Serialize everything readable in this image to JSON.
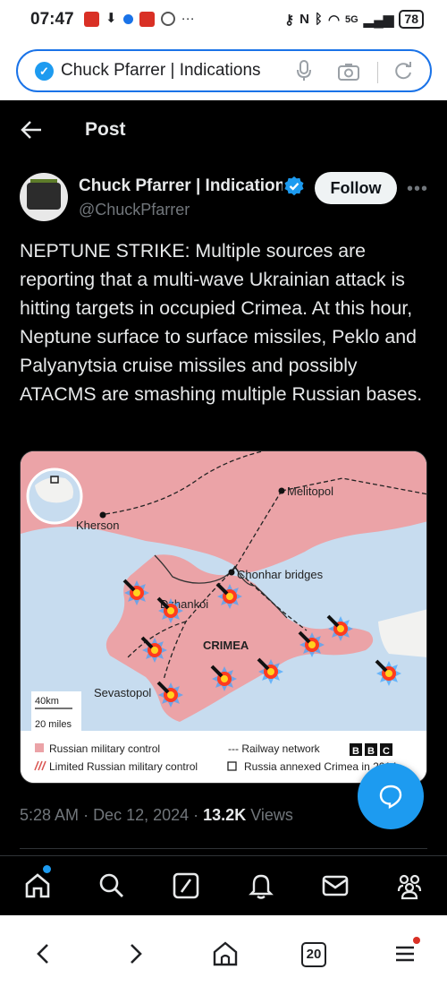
{
  "status_bar": {
    "time": "07:47",
    "signal": "5G",
    "battery": "78"
  },
  "address_bar": {
    "title": "Chuck Pfarrer | Indications"
  },
  "header": {
    "title": "Post"
  },
  "post": {
    "author_name": "Chuck Pfarrer | Indications",
    "author_handle": "@ChuckPfarrer",
    "follow_label": "Follow",
    "text": "NEPTUNE STRIKE: Multiple sources are reporting that a multi-wave Ukrainian attack is hitting targets in occupied Crimea. At this hour,  Neptune surface to surface missiles, Peklo and Palyanytsia cruise missiles and possibly ATACMS are smashing multiple Russian bases.",
    "time": "5:28 AM",
    "date": "Dec 12, 2024",
    "views_count": "13.2K",
    "views_label": "Views"
  },
  "map": {
    "labels": {
      "melitopol": "Melitopol",
      "kherson": "Kherson",
      "chonhar": "Chonhar bridges",
      "dzhankoi": "Dzhankoi",
      "crimea": "CRIMEA",
      "sevastopol": "Sevastopol",
      "scale_km": "40km",
      "scale_miles": "20 miles"
    },
    "legend": {
      "russian_control": "Russian military control",
      "limited_control": "Limited Russian military control",
      "railway": "--- Railway network",
      "annexed": "Russia annexed Crimea in 2014",
      "source": [
        "B",
        "B",
        "C"
      ]
    },
    "colors": {
      "sea": "#c7dcef",
      "land": "#f2f2f0",
      "controlled": "#eba3a7",
      "border": "#333333"
    }
  },
  "nav": {
    "items": [
      "home-icon",
      "search-icon",
      "grok-icon",
      "notifications-icon",
      "messages-icon",
      "communities-icon"
    ]
  },
  "browser_bottom": {
    "tab_count": "20"
  }
}
